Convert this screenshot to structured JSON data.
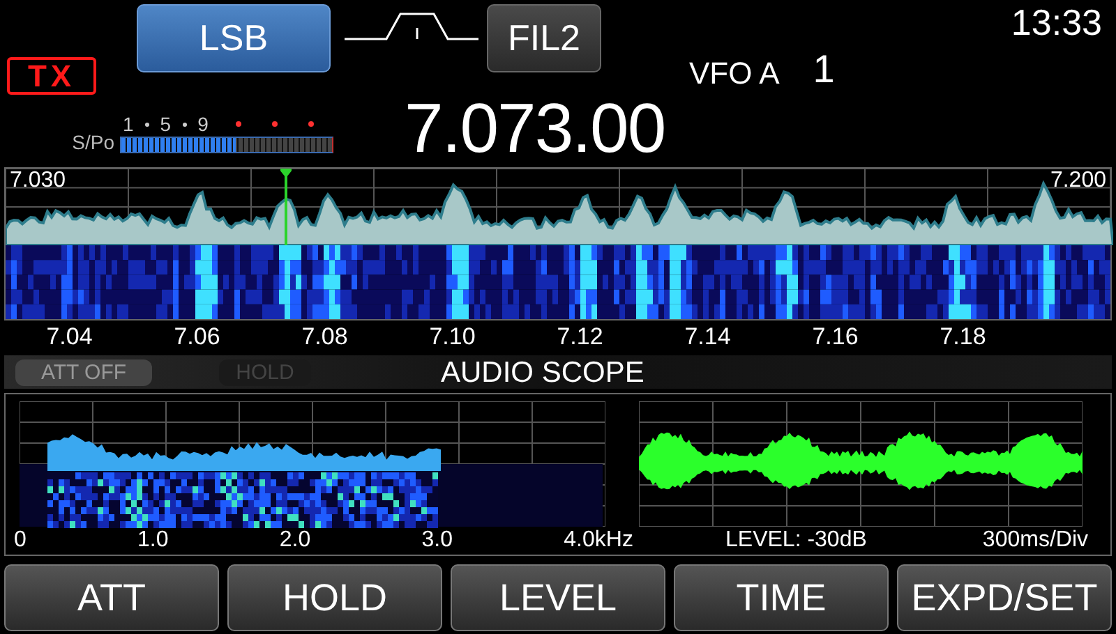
{
  "header": {
    "mode": "LSB",
    "filter": "FIL2",
    "clock": "13:33",
    "tx": "TX",
    "vfo": "VFO A",
    "memory": "1",
    "frequency": "7.073.00"
  },
  "meter": {
    "label": "S/Po",
    "scale": [
      "1",
      "5",
      "9"
    ],
    "level": 0.54
  },
  "scope": {
    "edge_low": "7.030",
    "edge_high": "7.200",
    "scale": [
      "7.04",
      "7.06",
      "7.08",
      "7.10",
      "7.12",
      "7.14",
      "7.16",
      "7.18"
    ]
  },
  "status": {
    "indicators": [
      {
        "label": "ATT OFF",
        "on": true
      },
      {
        "label": "HOLD",
        "on": false
      }
    ],
    "title": "AUDIO SCOPE"
  },
  "audio": {
    "fft_scale": [
      "0",
      "1.0",
      "2.0",
      "3.0",
      "4.0kHz"
    ],
    "level_reading": "LEVEL: -30dB",
    "time_div": "300ms/Div"
  },
  "buttons": [
    "ATT",
    "HOLD",
    "LEVEL",
    "TIME",
    "EXPD/SET"
  ]
}
